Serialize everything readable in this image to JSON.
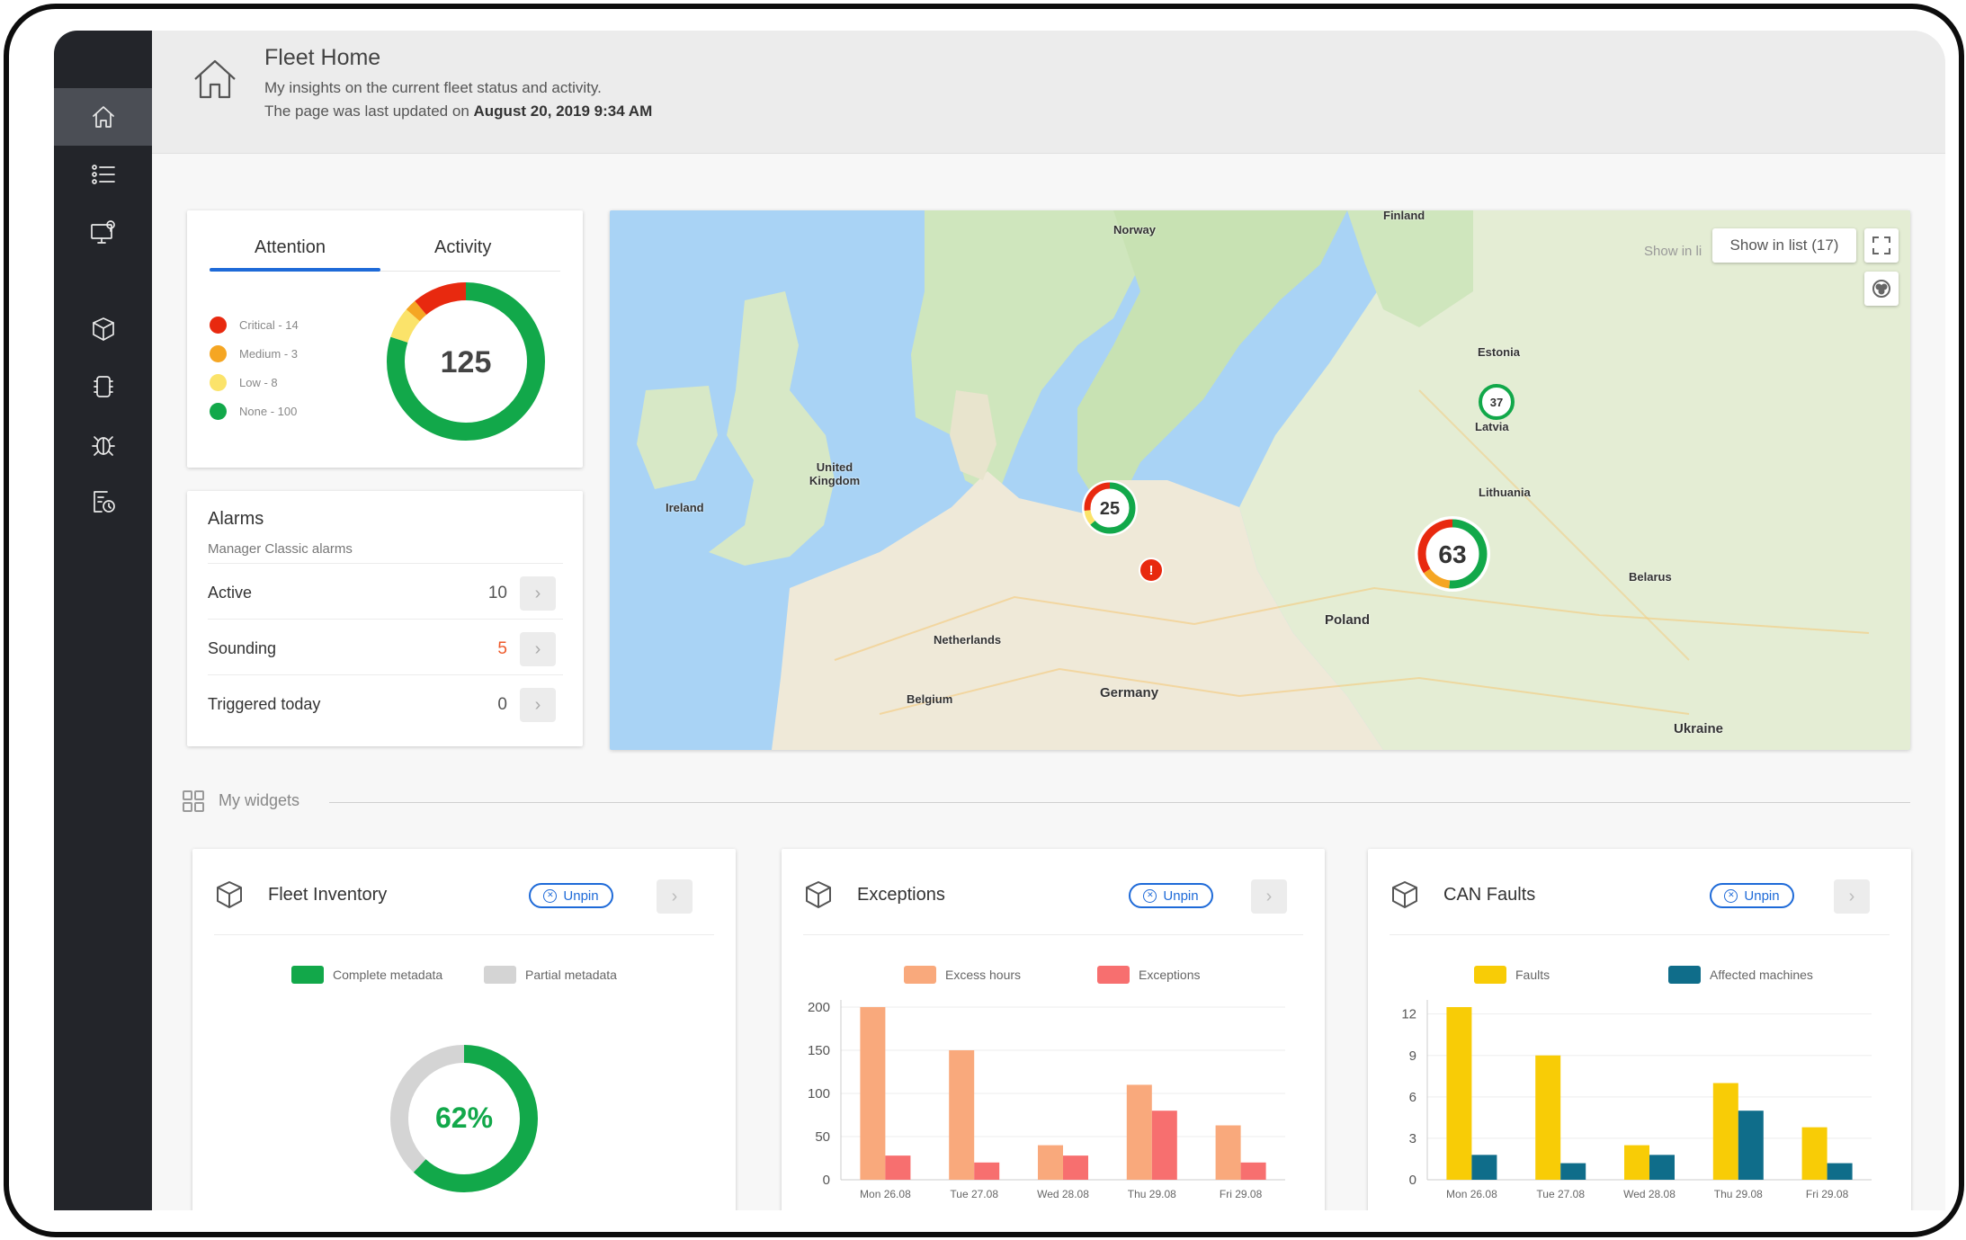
{
  "header": {
    "title": "Fleet Home",
    "subtitle": "My insights on the current fleet status and activity.",
    "updated_prefix": "The page was last updated on",
    "updated_value": "August 20, 2019 9:34 AM"
  },
  "sidebar": {
    "items": [
      {
        "icon": "home-icon",
        "active": true
      },
      {
        "icon": "list-icon"
      },
      {
        "icon": "monitor-pin-icon"
      },
      {
        "icon": "box-icon"
      },
      {
        "icon": "chip-icon"
      },
      {
        "icon": "bug-icon"
      },
      {
        "icon": "document-clock-icon"
      }
    ]
  },
  "attention": {
    "tabs": [
      "Attention",
      "Activity"
    ],
    "legend": [
      {
        "label": "Critical - 14",
        "color": "#e8290f"
      },
      {
        "label": "Medium - 3",
        "color": "#f5a623"
      },
      {
        "label": "Low - 8",
        "color": "#fbe36a"
      },
      {
        "label": "None - 100",
        "color": "#12a84a"
      }
    ],
    "total": "125",
    "segments": [
      {
        "name": "None",
        "value": 100,
        "color": "#12a84a"
      },
      {
        "name": "Low",
        "value": 8,
        "color": "#fbe36a"
      },
      {
        "name": "Medium",
        "value": 3,
        "color": "#f5a623"
      },
      {
        "name": "Critical",
        "value": 14,
        "color": "#e8290f"
      }
    ]
  },
  "alarms": {
    "title": "Alarms",
    "subtitle": "Manager Classic alarms",
    "rows": [
      {
        "label": "Active",
        "value": "10"
      },
      {
        "label": "Sounding",
        "value": "5"
      },
      {
        "label": "Triggered today",
        "value": "0"
      }
    ]
  },
  "map": {
    "show_in_list": "Show in list (17)",
    "show_ghost": "Show in li",
    "labels": [
      {
        "text": "Norway"
      },
      {
        "text": "Finland"
      },
      {
        "text": "United Kingdom"
      },
      {
        "text": "Ireland"
      },
      {
        "text": "Poland"
      },
      {
        "text": "Germany"
      },
      {
        "text": "Belarus"
      },
      {
        "text": "Ukraine"
      },
      {
        "text": "Estonia"
      },
      {
        "text": "Latvia"
      },
      {
        "text": "Lithuania"
      },
      {
        "text": "Netherlands"
      },
      {
        "text": "Belgium"
      }
    ],
    "clusters": [
      {
        "value": "25"
      },
      {
        "value": "63"
      },
      {
        "value": "37"
      }
    ],
    "alert": "!"
  },
  "widgets_header": "My widgets",
  "widgets": [
    {
      "title": "Fleet Inventory",
      "unpin": "Unpin",
      "legend": [
        {
          "label": "Complete metadata",
          "color": "#12a84a"
        },
        {
          "label": "Partial metadata",
          "color": "#d4d4d4"
        }
      ],
      "chart_data": {
        "type": "pie",
        "center_label": "62%",
        "slices": [
          {
            "name": "Complete metadata",
            "value": 62
          },
          {
            "name": "Partial metadata",
            "value": 38
          }
        ]
      }
    },
    {
      "title": "Exceptions",
      "unpin": "Unpin",
      "legend": [
        {
          "label": "Excess hours",
          "color": "#f9a97c"
        },
        {
          "label": "Exceptions",
          "color": "#f76f6f"
        }
      ],
      "chart_data": {
        "type": "bar",
        "categories": [
          "Mon 26.08",
          "Tue 27.08",
          "Wed 28.08",
          "Thu 29.08",
          "Fri 29.08"
        ],
        "series": [
          {
            "name": "Excess hours",
            "values": [
              200,
              150,
              40,
              110,
              63
            ],
            "color": "#f9a97c"
          },
          {
            "name": "Exceptions",
            "values": [
              28,
              20,
              28,
              80,
              20
            ],
            "color": "#f76f6f"
          }
        ],
        "yticks": [
          "200",
          "150",
          "100",
          "50",
          "0"
        ],
        "ytick_values": [
          200,
          150,
          100,
          50,
          0
        ],
        "ylim": [
          0,
          200
        ]
      }
    },
    {
      "title": "CAN Faults",
      "unpin": "Unpin",
      "legend": [
        {
          "label": "Faults",
          "color": "#f8cc06"
        },
        {
          "label": "Affected machines",
          "color": "#0f6d8a"
        }
      ],
      "chart_data": {
        "type": "bar",
        "categories": [
          "Mon 26.08",
          "Tue 27.08",
          "Wed 28.08",
          "Thu 29.08",
          "Fri 29.08"
        ],
        "series": [
          {
            "name": "Faults",
            "values": [
              12.5,
              9,
              2.5,
              7,
              3.8
            ],
            "color": "#f8cc06"
          },
          {
            "name": "Affected machines",
            "values": [
              1.8,
              1.2,
              1.8,
              5,
              1.2
            ],
            "color": "#0f6d8a"
          }
        ],
        "yticks": [
          "12",
          "9",
          "6",
          "3",
          "0"
        ],
        "ytick_values": [
          12,
          9,
          6,
          3,
          0
        ],
        "ylim": [
          0,
          12.5
        ]
      }
    }
  ]
}
